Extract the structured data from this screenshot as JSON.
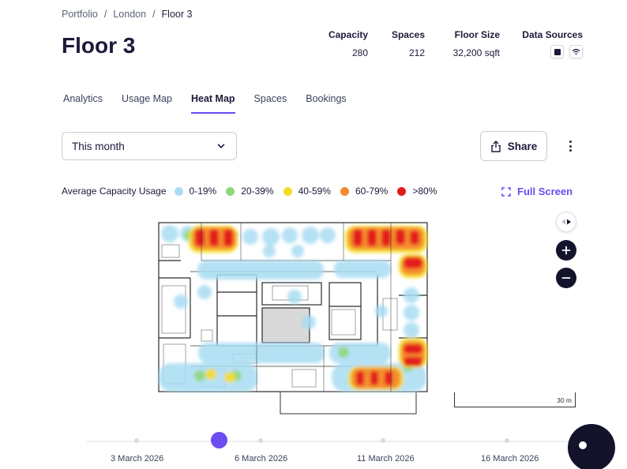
{
  "breadcrumb": {
    "items": [
      "Portfolio",
      "London",
      "Floor 3"
    ],
    "separator": "/"
  },
  "page": {
    "title": "Floor 3"
  },
  "stats": {
    "capacity": {
      "label": "Capacity",
      "value": "280"
    },
    "spaces": {
      "label": "Spaces",
      "value": "212"
    },
    "floor_size": {
      "label": "Floor Size",
      "value": "32,200 sqft"
    },
    "data_sources": {
      "label": "Data Sources",
      "icons": [
        "sensor-icon",
        "wifi-icon"
      ]
    }
  },
  "tabs": [
    {
      "label": "Analytics",
      "active": false
    },
    {
      "label": "Usage Map",
      "active": false
    },
    {
      "label": "Heat Map",
      "active": true
    },
    {
      "label": "Spaces",
      "active": false
    },
    {
      "label": "Bookings",
      "active": false
    }
  ],
  "period_select": {
    "value": "This month"
  },
  "share_button": {
    "label": "Share"
  },
  "legend": {
    "title": "Average Capacity Usage",
    "items": [
      {
        "label": "0-19%",
        "color": "#a8dcf2"
      },
      {
        "label": "20-39%",
        "color": "#8fd87a"
      },
      {
        "label": "40-59%",
        "color": "#f5dc2a"
      },
      {
        "label": "60-79%",
        "color": "#f5892f"
      },
      {
        "label": ">80%",
        "color": "#e41b1b"
      }
    ]
  },
  "fullscreen": {
    "label": "Full Screen"
  },
  "map": {
    "scale_label": "30 m"
  },
  "timeline": {
    "labels": [
      "3 March 2026",
      "6 March 2026",
      "11 March 2026",
      "16 March 2026"
    ],
    "selected_index": 1
  },
  "colors": {
    "accent": "#6a4cf0",
    "dark": "#14132c"
  }
}
